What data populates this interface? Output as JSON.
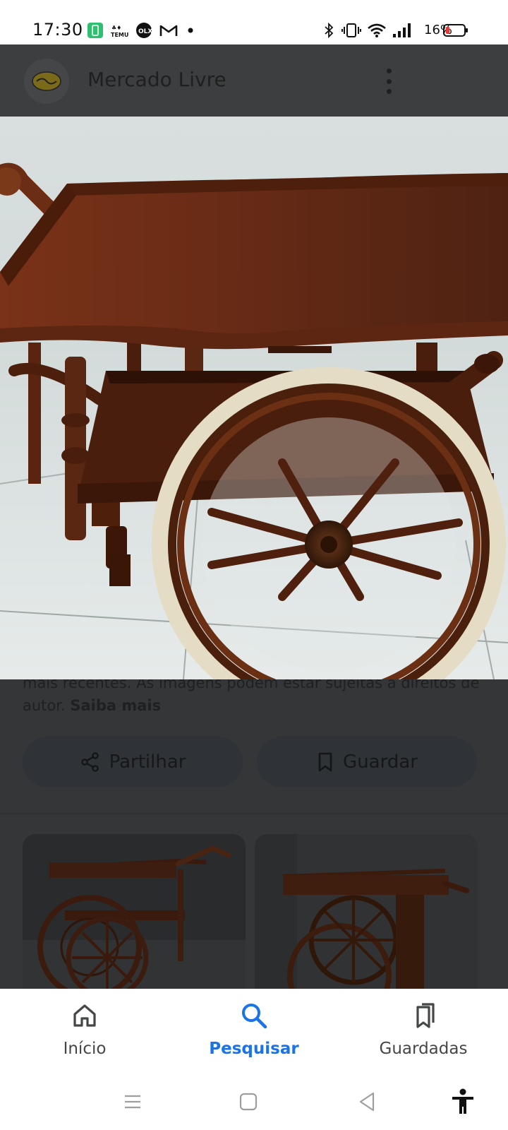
{
  "status_bar": {
    "time": "17:30",
    "battery_percent": "16%",
    "icons": [
      "phone-charging-icon",
      "temu-icon",
      "olx-icon",
      "gmail-icon",
      "dot-icon",
      "bluetooth-icon",
      "vibrate-icon",
      "wifi-icon",
      "signal-icon",
      "battery-icon"
    ]
  },
  "header": {
    "site_name": "Mercado Livre",
    "logo_icon": "handshake-icon",
    "menu_icon": "more-vert-icon"
  },
  "disclaimer": {
    "text_line1": "mais recentes. As imagens podem estar sujeitas a direitos de",
    "text_line2": "autor.",
    "link": "Saiba mais"
  },
  "actions": {
    "share_label": "Partilhar",
    "save_label": "Guardar"
  },
  "bottom_nav": {
    "items": [
      {
        "label": "Início",
        "icon": "home-icon",
        "active": false
      },
      {
        "label": "Pesquisar",
        "icon": "search-icon",
        "active": true
      },
      {
        "label": "Guardadas",
        "icon": "bookmarks-icon",
        "active": false
      }
    ]
  },
  "colors": {
    "accent": "#1a73e8",
    "wood": "#5a2a16",
    "wheel_rim": "#e8e0c8"
  }
}
